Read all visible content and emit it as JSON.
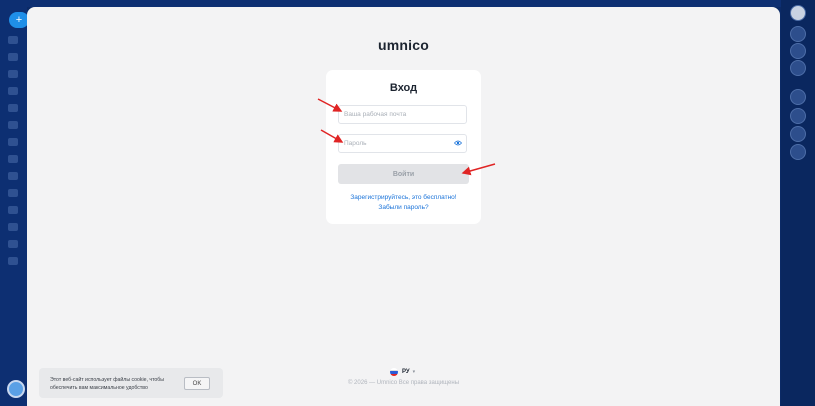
{
  "brand": {
    "logo_text": "umnico"
  },
  "background": {
    "plus_label": "+"
  },
  "login": {
    "title": "Вход",
    "email_placeholder": "Ваша рабочая почта",
    "password_placeholder": "Пароль",
    "submit_label": "Войти",
    "register_link": "Зарегистрируйтесь, это бесплатно!",
    "forgot_link": "Забыли пароль?"
  },
  "footer": {
    "language": "РУ",
    "copyright": "© 2026 — Umnico Все права защищены"
  },
  "cookie_banner": {
    "text": "Этот веб-сайт использует файлы cookie, чтобы обеспечить вам максимальное удобство",
    "ok_label": "OK"
  },
  "colors": {
    "accent": "#1a73d9",
    "annotation_arrow": "#e02424",
    "background": "#0b2a66"
  },
  "icons": [
    "eye-icon",
    "russia-flag-icon",
    "chevron-down-icon",
    "bell-icon",
    "avatar-icon"
  ]
}
